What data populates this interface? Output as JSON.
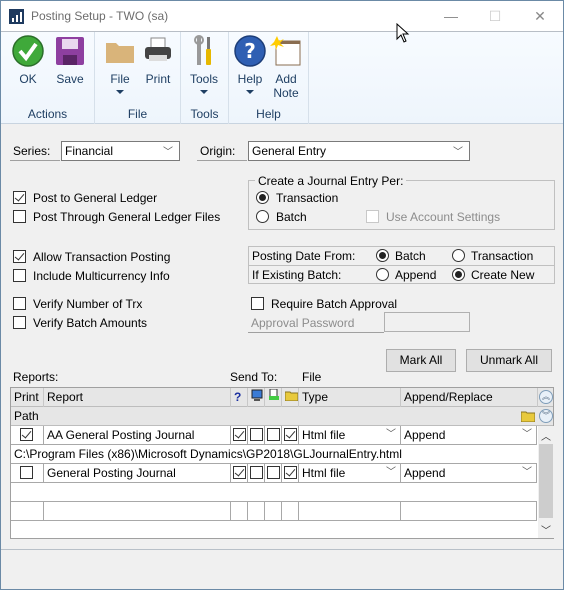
{
  "window": {
    "title": "Posting Setup  -  TWO (sa)",
    "controls": {
      "minimize": "—",
      "maximize": "☐",
      "close": "✕"
    }
  },
  "ribbon": {
    "groups": [
      {
        "label": "Actions",
        "buttons": [
          {
            "label": "OK",
            "icon": "ok-check-icon"
          },
          {
            "label": "Save",
            "icon": "save-disk-icon"
          }
        ]
      },
      {
        "label": "File",
        "buttons": [
          {
            "label": "File",
            "icon": "folder-icon",
            "dropdown": true
          },
          {
            "label": "Print",
            "icon": "printer-icon"
          }
        ]
      },
      {
        "label": "Tools",
        "buttons": [
          {
            "label": "Tools",
            "icon": "tools-icon",
            "dropdown": true
          }
        ]
      },
      {
        "label": "Help",
        "buttons": [
          {
            "label": "Help",
            "icon": "help-icon",
            "dropdown": true
          },
          {
            "label": "Add",
            "label2": "Note",
            "icon": "add-note-icon"
          }
        ]
      }
    ]
  },
  "form": {
    "series_label": "Series:",
    "series_value": "Financial",
    "origin_label": "Origin:",
    "origin_value": "General Entry",
    "post_to_gl": {
      "label": "Post to General Ledger",
      "checked": true
    },
    "post_through_gl": {
      "label": "Post Through General Ledger Files",
      "checked": false
    },
    "journal_entry_group": {
      "title": "Create a Journal Entry Per:",
      "transaction": {
        "label": "Transaction",
        "selected": true
      },
      "batch": {
        "label": "Batch",
        "selected": false
      },
      "use_account_settings": {
        "label": "Use Account Settings",
        "checked": false,
        "disabled": true
      }
    },
    "allow_trx_posting": {
      "label": "Allow Transaction Posting",
      "checked": true
    },
    "include_multicurrency": {
      "label": "Include Multicurrency Info",
      "checked": false
    },
    "posting_date_from": {
      "label": "Posting Date From:",
      "options": [
        "Batch",
        "Transaction"
      ],
      "selected": "Batch"
    },
    "if_existing_batch": {
      "label": "If Existing Batch:",
      "options": [
        "Append",
        "Create New"
      ],
      "selected": "Create New"
    },
    "verify_number_trx": {
      "label": "Verify Number of Trx",
      "checked": false
    },
    "verify_batch_amounts": {
      "label": "Verify Batch Amounts",
      "checked": false
    },
    "require_batch_approval": {
      "label": "Require Batch Approval",
      "checked": false
    },
    "approval_password": {
      "label": "Approval Password",
      "value": ""
    }
  },
  "reports": {
    "mark_all": "Mark All",
    "unmark_all": "Unmark All",
    "reports_label": "Reports:",
    "send_to_label": "Send To:",
    "file_label": "File",
    "columns": {
      "print": "Print",
      "report": "Report",
      "help": "?",
      "type": "Type",
      "append_replace": "Append/Replace",
      "path": "Path"
    },
    "rows": [
      {
        "print": true,
        "report": "AA General Posting Journal",
        "s1": true,
        "s2": false,
        "s3": false,
        "s4": true,
        "type": "Html file",
        "append_replace": "Append",
        "path": "C:\\Program Files (x86)\\Microsoft Dynamics\\GP2018\\GLJournalEntry.html"
      },
      {
        "print": false,
        "report": "General Posting Journal",
        "s1": true,
        "s2": false,
        "s3": false,
        "s4": true,
        "type": "Html file",
        "append_replace": "Append",
        "path": ""
      }
    ]
  }
}
